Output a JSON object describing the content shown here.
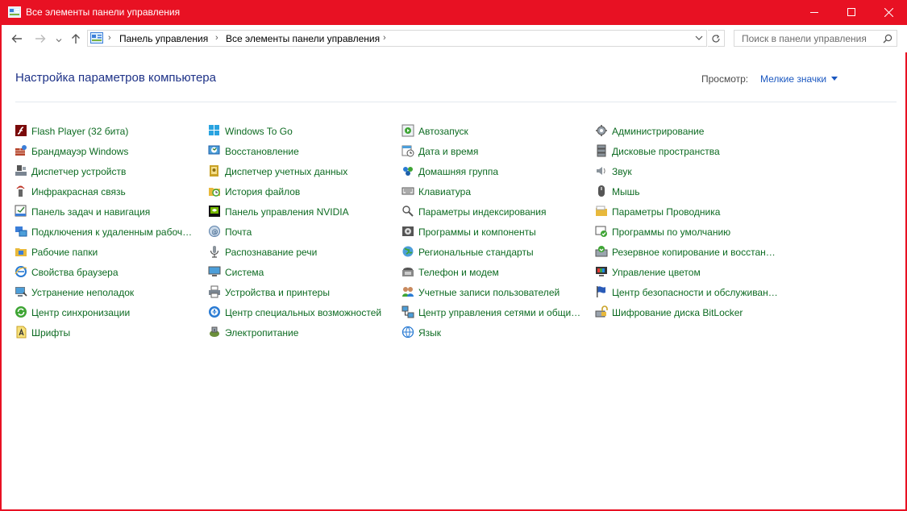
{
  "window": {
    "title": "Все элементы панели управления",
    "accent": "#e81123"
  },
  "address": {
    "crumbs": [
      "Панель управления",
      "Все элементы панели управления"
    ]
  },
  "search": {
    "placeholder": "Поиск в панели управления"
  },
  "header": {
    "title": "Настройка параметров компьютера",
    "view_label": "Просмотр:",
    "view_value": "Мелкие значки"
  },
  "colors": {
    "item_text": "#0d6b22",
    "title_text": "#1e3287",
    "link": "#1a57c0"
  },
  "items": [
    {
      "label": "Flash Player (32 бита)",
      "icon": "flash-icon"
    },
    {
      "label": "Брандмауэр Windows",
      "icon": "firewall-icon"
    },
    {
      "label": "Диспетчер устройств",
      "icon": "device-manager-icon"
    },
    {
      "label": "Инфракрасная связь",
      "icon": "infrared-icon"
    },
    {
      "label": "Панель задач и навигация",
      "icon": "taskbar-icon"
    },
    {
      "label": "Подключения к удаленным рабоч…",
      "icon": "remote-desktop-icon"
    },
    {
      "label": "Рабочие папки",
      "icon": "work-folders-icon"
    },
    {
      "label": "Свойства браузера",
      "icon": "browser-icon"
    },
    {
      "label": "Устранение неполадок",
      "icon": "troubleshoot-icon"
    },
    {
      "label": "Центр синхронизации",
      "icon": "sync-icon"
    },
    {
      "label": "Шрифты",
      "icon": "fonts-icon"
    },
    {
      "label": "Windows To Go",
      "icon": "windows-to-go-icon"
    },
    {
      "label": "Восстановление",
      "icon": "recovery-icon"
    },
    {
      "label": "Диспетчер учетных данных",
      "icon": "credential-icon"
    },
    {
      "label": "История файлов",
      "icon": "file-history-icon"
    },
    {
      "label": "Панель управления NVIDIA",
      "icon": "nvidia-icon"
    },
    {
      "label": "Почта",
      "icon": "mail-icon"
    },
    {
      "label": "Распознавание речи",
      "icon": "speech-icon"
    },
    {
      "label": "Система",
      "icon": "system-icon"
    },
    {
      "label": "Устройства и принтеры",
      "icon": "printer-icon"
    },
    {
      "label": "Центр специальных возможностей",
      "icon": "accessibility-icon"
    },
    {
      "label": "Электропитание",
      "icon": "power-icon"
    },
    {
      "label": "Автозапуск",
      "icon": "autoplay-icon"
    },
    {
      "label": "Дата и время",
      "icon": "datetime-icon"
    },
    {
      "label": "Домашняя группа",
      "icon": "homegroup-icon"
    },
    {
      "label": "Клавиатура",
      "icon": "keyboard-icon"
    },
    {
      "label": "Параметры индексирования",
      "icon": "indexing-icon"
    },
    {
      "label": "Программы и компоненты",
      "icon": "programs-icon"
    },
    {
      "label": "Региональные стандарты",
      "icon": "region-icon"
    },
    {
      "label": "Телефон и модем",
      "icon": "phone-icon"
    },
    {
      "label": "Учетные записи пользователей",
      "icon": "users-icon"
    },
    {
      "label": "Центр управления сетями и общи…",
      "icon": "network-icon"
    },
    {
      "label": "Язык",
      "icon": "language-icon"
    },
    {
      "label": "Администрирование",
      "icon": "admin-tools-icon"
    },
    {
      "label": "Дисковые пространства",
      "icon": "storage-spaces-icon"
    },
    {
      "label": "Звук",
      "icon": "sound-icon"
    },
    {
      "label": "Мышь",
      "icon": "mouse-icon"
    },
    {
      "label": "Параметры Проводника",
      "icon": "explorer-options-icon"
    },
    {
      "label": "Программы по умолчанию",
      "icon": "default-programs-icon"
    },
    {
      "label": "Резервное копирование и восстан…",
      "icon": "backup-icon"
    },
    {
      "label": "Управление цветом",
      "icon": "color-management-icon"
    },
    {
      "label": "Центр безопасности и обслуживан…",
      "icon": "security-flag-icon"
    },
    {
      "label": "Шифрование диска BitLocker",
      "icon": "bitlocker-icon"
    }
  ]
}
